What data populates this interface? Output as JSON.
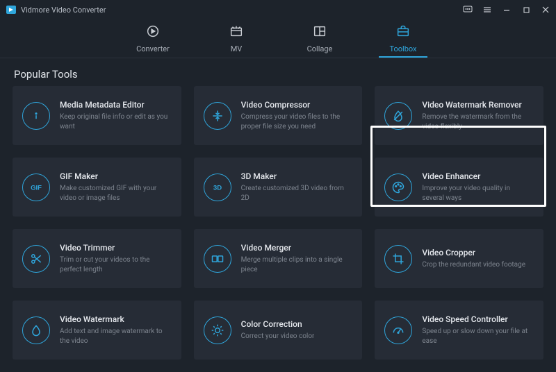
{
  "app": {
    "title": "Vidmore Video Converter"
  },
  "tabs": {
    "converter": {
      "label": "Converter"
    },
    "mv": {
      "label": "MV"
    },
    "collage": {
      "label": "Collage"
    },
    "toolbox": {
      "label": "Toolbox"
    }
  },
  "section": {
    "title": "Popular Tools"
  },
  "tools": {
    "metadata": {
      "title": "Media Metadata Editor",
      "desc": "Keep original file info or edit as you want"
    },
    "compressor": {
      "title": "Video Compressor",
      "desc": "Compress your video files to the proper file size you need"
    },
    "watermarkRemover": {
      "title": "Video Watermark Remover",
      "desc": "Remove the watermark from the video flexibly"
    },
    "gif": {
      "title": "GIF Maker",
      "desc": "Make customized GIF with your video or image files"
    },
    "threeD": {
      "title": "3D Maker",
      "desc": "Create customized 3D video from 2D"
    },
    "enhancer": {
      "title": "Video Enhancer",
      "desc": "Improve your video quality in several ways"
    },
    "trimmer": {
      "title": "Video Trimmer",
      "desc": "Trim or cut your videos to the perfect length"
    },
    "merger": {
      "title": "Video Merger",
      "desc": "Merge multiple clips into a single piece"
    },
    "cropper": {
      "title": "Video Cropper",
      "desc": "Crop the redundant video footage"
    },
    "watermark": {
      "title": "Video Watermark",
      "desc": "Add text and image watermark to the video"
    },
    "color": {
      "title": "Color Correction",
      "desc": "Correct your video color"
    },
    "speed": {
      "title": "Video Speed Controller",
      "desc": "Speed up or slow down your file at ease"
    }
  }
}
